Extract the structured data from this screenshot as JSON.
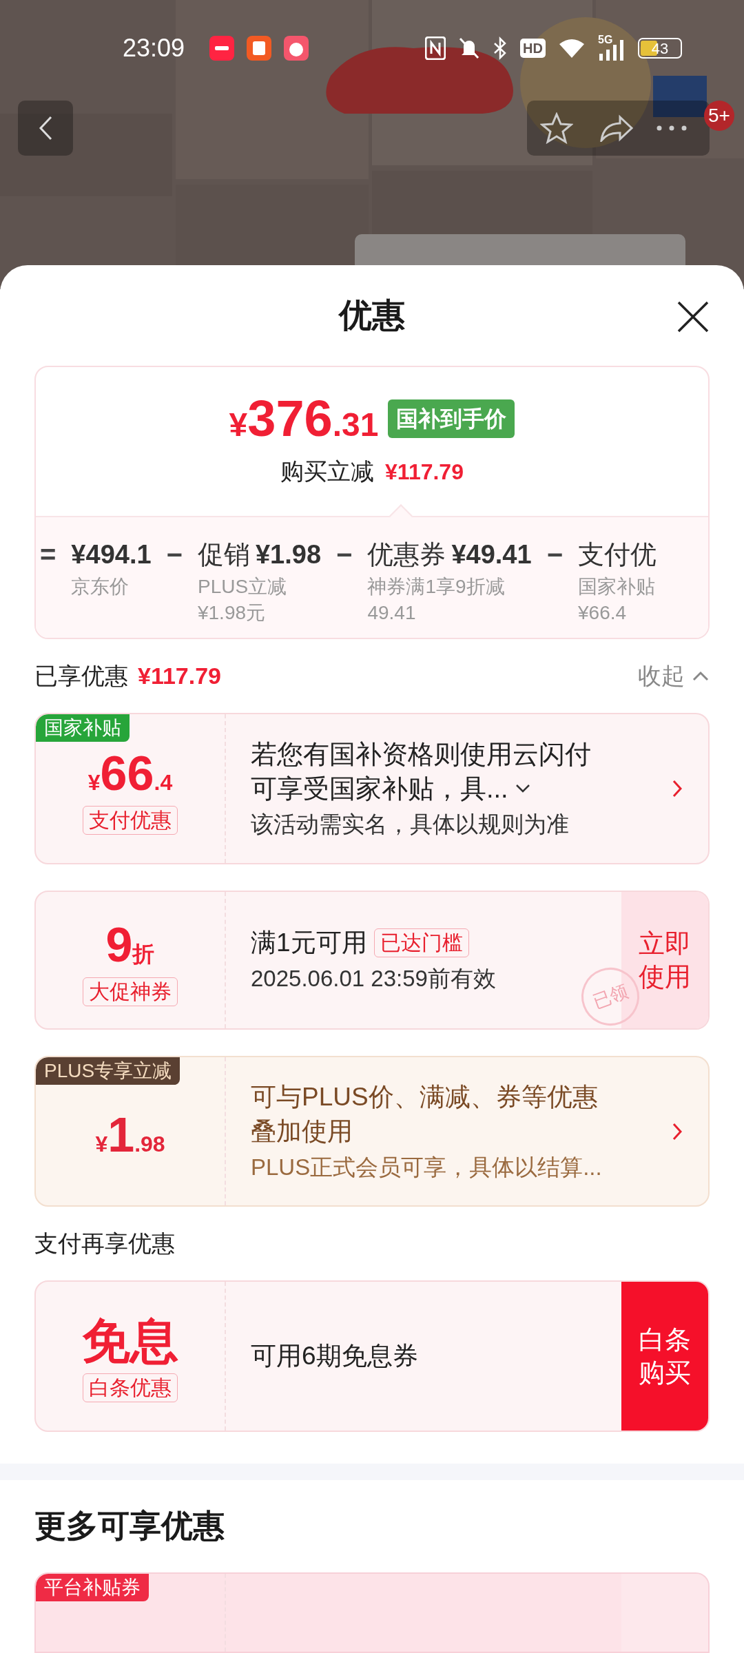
{
  "status_bar": {
    "time": "23:09",
    "hd_label": "HD",
    "network": "5G",
    "battery": "43"
  },
  "nav": {
    "badge": "5+"
  },
  "sheet": {
    "title": "优惠"
  },
  "summary": {
    "currency": "¥",
    "price_main": "376",
    "price_minor": ".31",
    "tag": "国补到手价",
    "saving_label": "购买立减",
    "saving": "¥117.79",
    "breakdown": [
      {
        "operator": "=",
        "amount": "¥494.1",
        "notes": [
          "京东价"
        ]
      },
      {
        "operator": "−",
        "label": "促销",
        "amount": "¥1.98",
        "notes": [
          "PLUS立减",
          "¥1.98元"
        ]
      },
      {
        "operator": "−",
        "label": "优惠券",
        "amount": "¥49.41",
        "notes": [
          "神券满1享9折减",
          "49.41"
        ]
      },
      {
        "operator": "−",
        "label": "支付优",
        "notes": [
          "国家补贴",
          "¥66.4"
        ]
      }
    ]
  },
  "enjoyed": {
    "label": "已享优惠",
    "amount": "¥117.79",
    "toggle": "收起",
    "expanded": true
  },
  "coupons": [
    {
      "kind": "subsidy",
      "tag": "国家补贴",
      "currency": "¥",
      "main": "66",
      "minor": ".4",
      "badge": "支付优惠",
      "title_lines": [
        "若您有国补资格则使用云闪付",
        "可享受国家补贴，具..."
      ],
      "expandable": true,
      "desc": "该活动需实名，具体以规则为准",
      "arrow": true
    },
    {
      "kind": "coupon",
      "main": "9",
      "minor": "折",
      "badge": "大促神券",
      "title": "满1元可用",
      "title_tag": "已达门槛",
      "desc": "2025.06.01 23:59前有效",
      "button": "立即使用",
      "stamp": "已领"
    },
    {
      "kind": "plus",
      "tag": "PLUS专享立减",
      "currency": "¥",
      "main": "1",
      "minor": ".98",
      "title": "可与PLUS价、满减、券等优惠叠加使用",
      "desc": "PLUS正式会员可享，具体以结算...",
      "arrow": true
    }
  ],
  "pay_section": {
    "label": "支付再享优惠",
    "coupons": [
      {
        "kind": "credit",
        "main": "免息",
        "badge": "白条优惠",
        "title": "可用6期免息券",
        "button": "白条购买"
      }
    ]
  },
  "more_section": {
    "title": "更多可享优惠",
    "coupons": [
      {
        "kind": "platform",
        "tag": "平台补贴券"
      }
    ]
  }
}
